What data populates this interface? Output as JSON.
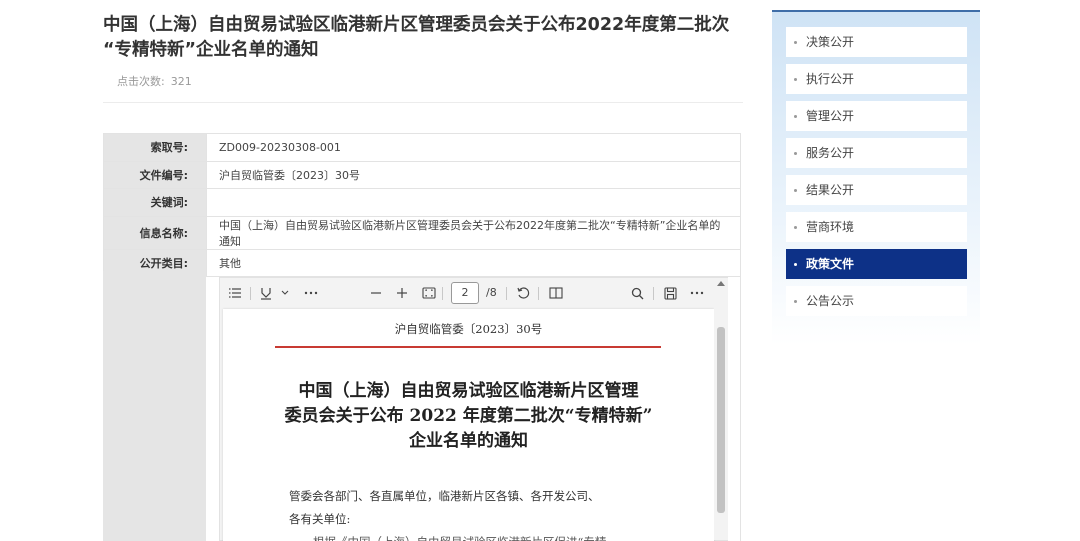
{
  "article": {
    "title_line1": "中国（上海）自由贸易试验区临港新片区管理委员会关于公布2022年度第二批次",
    "title_line2": "“专精特新”企业名单的通知",
    "clicks_label": "点击次数:",
    "clicks_value": "321"
  },
  "meta": {
    "rows": [
      {
        "key": "索取号:",
        "value": "ZD009-20230308-001"
      },
      {
        "key": "文件编号:",
        "value": "沪自贸临管委〔2023〕30号"
      },
      {
        "key": "关键词:",
        "value": ""
      },
      {
        "key": "信息名称:",
        "value": "中国（上海）自由贸易试验区临港新片区管理委员会关于公布2022年度第二批次“专精特新”企业名单的通知"
      },
      {
        "key": "公开类目:",
        "value": "其他"
      }
    ]
  },
  "viewer": {
    "current_page": "2",
    "total_pages": "/8",
    "doc_number": "沪自贸临管委〔2023〕30号",
    "doc_title_line1": "中国（上海）自由贸易试验区临港新片区管理",
    "doc_title_line2": "委员会关于公布 2022 年度第二批次“专精特新”",
    "doc_title_line3": "企业名单的通知",
    "body_line1": "管委会各部门、各直属单位，临港新片区各镇、各开发公司、",
    "body_line2": "各有关单位:",
    "body_line3": "根据《中国（上海）自由贸易试验区临港新片区促进“专精"
  },
  "sidebar": {
    "items": [
      {
        "label": "决策公开"
      },
      {
        "label": "执行公开"
      },
      {
        "label": "管理公开"
      },
      {
        "label": "服务公开"
      },
      {
        "label": "结果公开"
      },
      {
        "label": "营商环境"
      },
      {
        "label": "政策文件"
      },
      {
        "label": "公告公示"
      }
    ],
    "active_color": "#0d3187"
  }
}
